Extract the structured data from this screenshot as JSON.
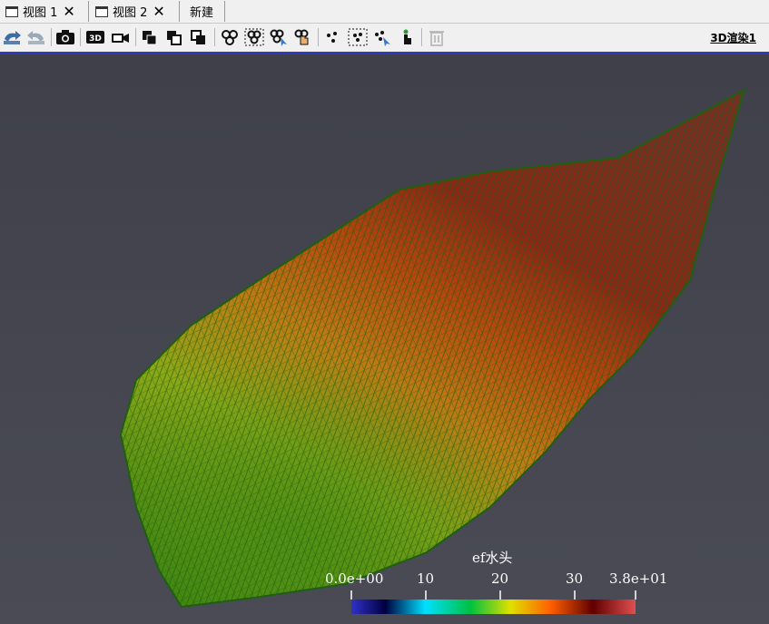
{
  "tabs": [
    {
      "label": "视图 1",
      "close": "✕"
    },
    {
      "label": "视图 2",
      "close": "✕"
    },
    {
      "label": "新建"
    }
  ],
  "toolbar": {
    "view_label": "3D渲染1",
    "buttons": [
      "reset-camera-icon",
      "redo-camera-icon",
      "camera-icon",
      "3d-icon",
      "video-camera-icon",
      "layer-front-icon",
      "layer-back-icon",
      "layer-both-icon",
      "select-cells-icon",
      "select-cells-frustum-icon",
      "interactive-select-cells-icon",
      "hover-cells-icon",
      "select-points-icon",
      "select-points-frustum-icon",
      "interactive-select-points-icon",
      "hover-points-icon",
      "delete-selection-icon"
    ],
    "three_d": "3D"
  },
  "legend": {
    "title": "ef水头",
    "ticks": [
      "0.0e+00",
      "10",
      "20",
      "30",
      "3.8e+01"
    ],
    "range": [
      0,
      38
    ],
    "colormap": [
      "#3030c8",
      "#000040",
      "#00e0ff",
      "#00c040",
      "#e0e000",
      "#ff6000",
      "#600000",
      "#e05050"
    ]
  },
  "colors": {
    "viewport_bg": "#43444e",
    "mesh_green": "#4a8a10",
    "mesh_yellow": "#b8b418",
    "mesh_orange": "#c06010",
    "mesh_red": "#8a2418",
    "wireframe": "#1e6010",
    "active_border": "#2f3bbf"
  }
}
